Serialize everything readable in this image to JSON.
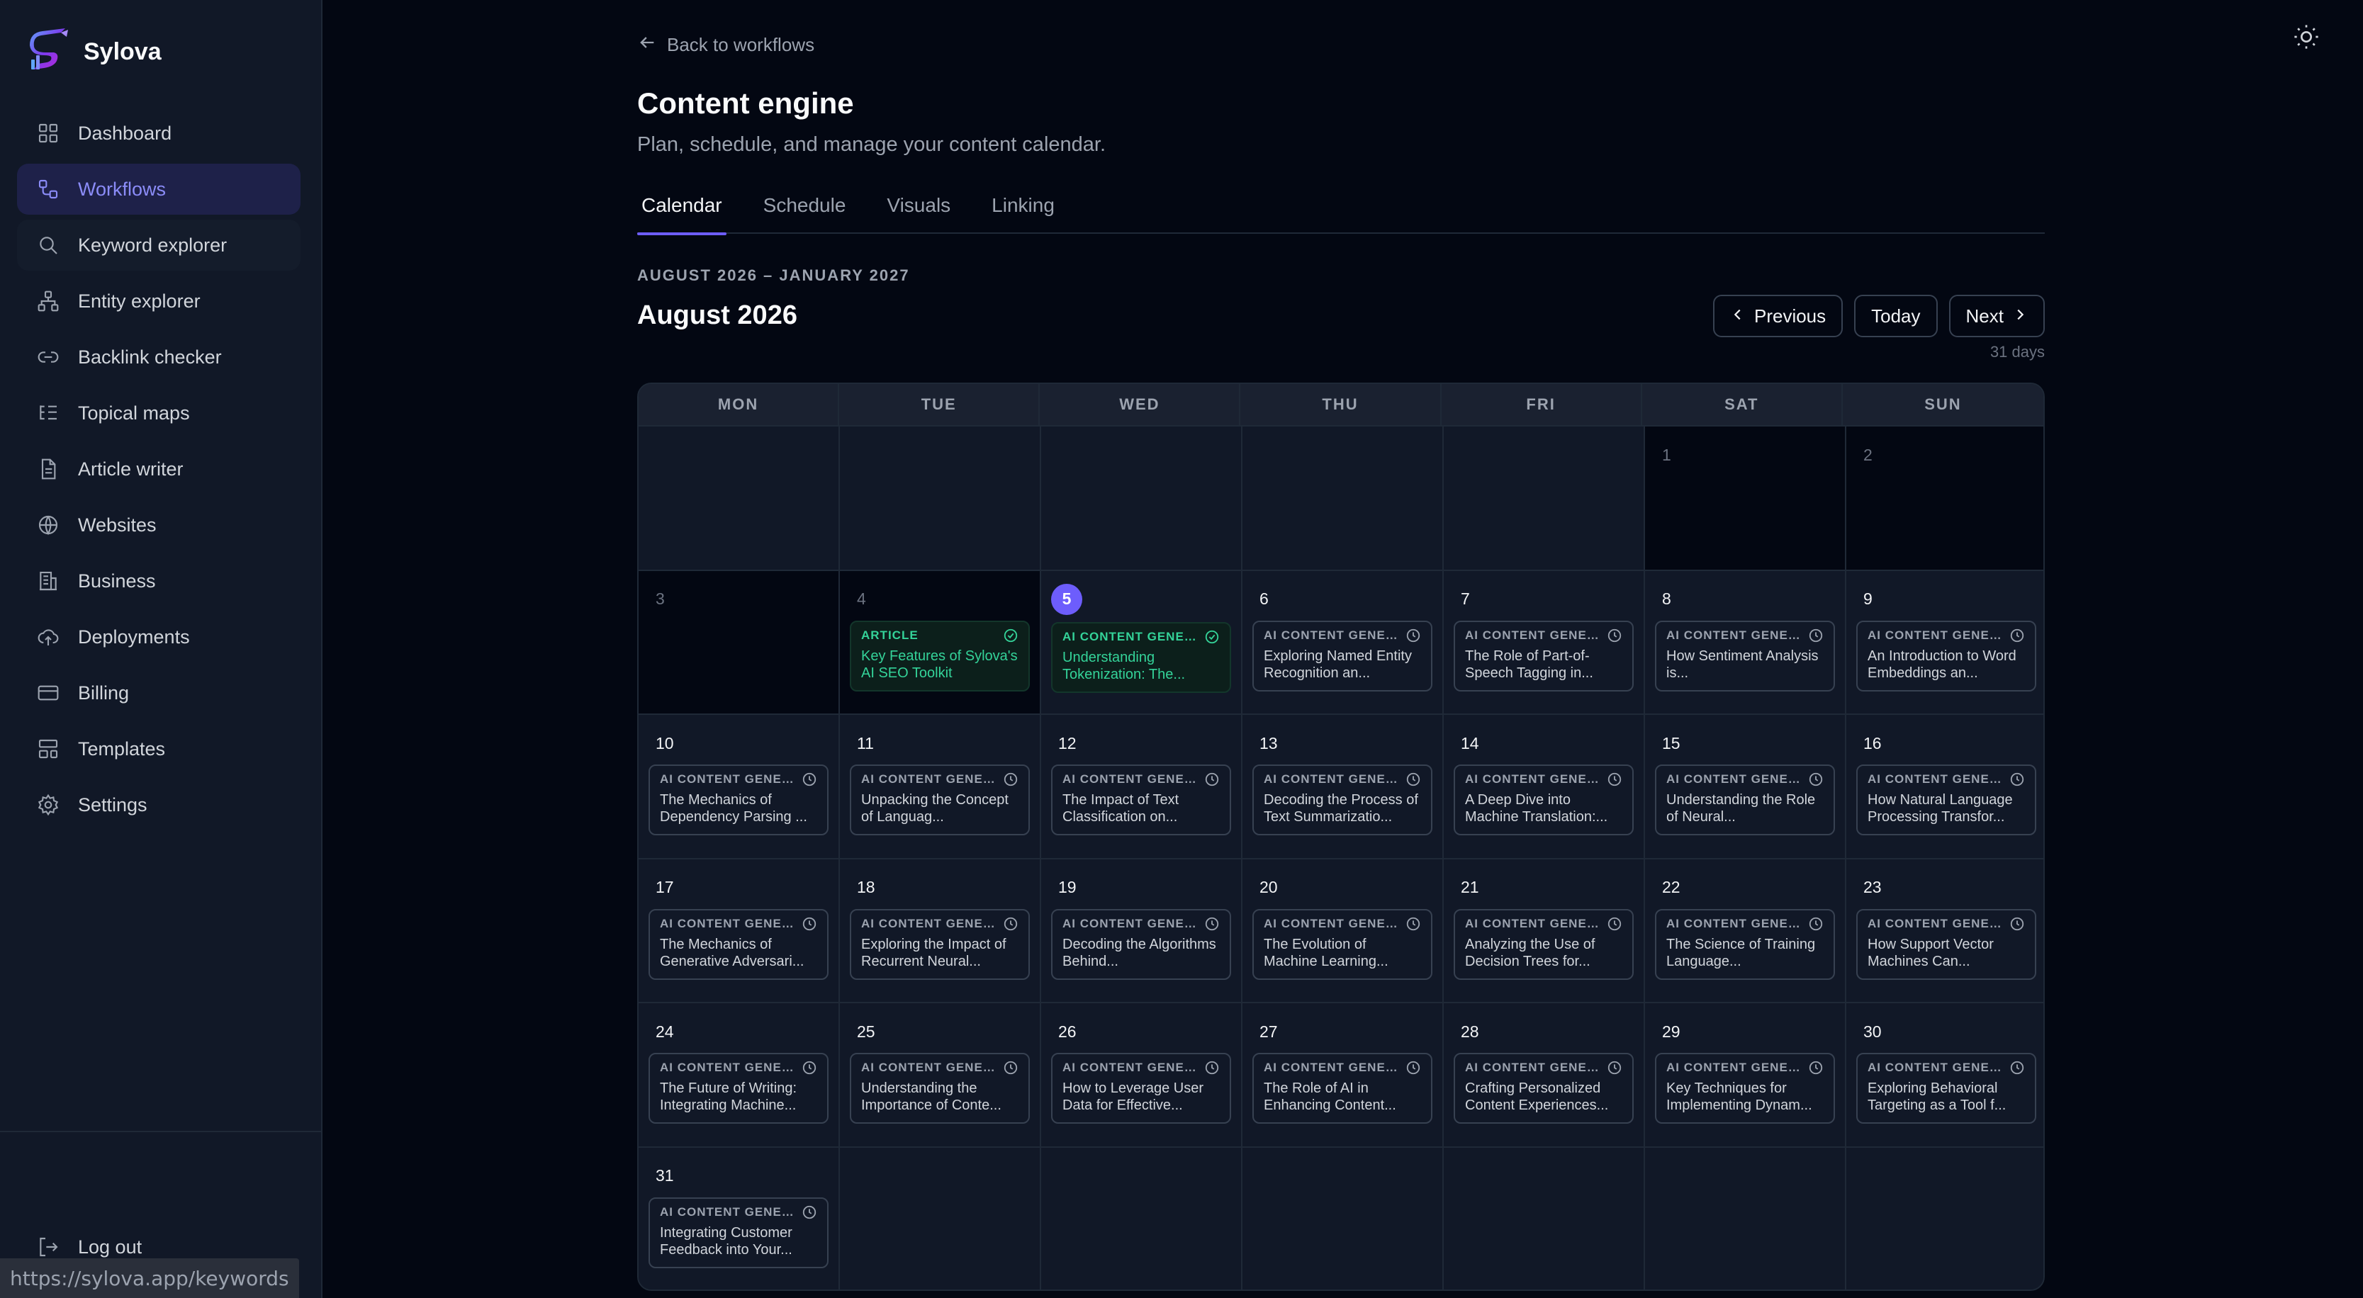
{
  "app": {
    "name": "Sylova"
  },
  "sidebar": {
    "items": [
      {
        "label": "Dashboard",
        "icon": "dashboard-icon"
      },
      {
        "label": "Workflows",
        "icon": "workflows-icon",
        "active": true
      },
      {
        "label": "Keyword explorer",
        "icon": "search-icon",
        "hover": true
      },
      {
        "label": "Entity explorer",
        "icon": "entity-icon"
      },
      {
        "label": "Backlink checker",
        "icon": "link-icon"
      },
      {
        "label": "Topical maps",
        "icon": "list-tree-icon"
      },
      {
        "label": "Article writer",
        "icon": "document-icon"
      },
      {
        "label": "Websites",
        "icon": "globe-icon"
      },
      {
        "label": "Business",
        "icon": "building-icon"
      },
      {
        "label": "Deployments",
        "icon": "cloud-upload-icon"
      },
      {
        "label": "Billing",
        "icon": "credit-card-icon"
      },
      {
        "label": "Templates",
        "icon": "templates-icon"
      },
      {
        "label": "Settings",
        "icon": "gear-icon"
      }
    ],
    "logout": "Log out"
  },
  "status_url": "https://sylova.app/keywords",
  "header": {
    "back": "Back to workflows",
    "title": "Content engine",
    "subtitle": "Plan, schedule, and manage your content calendar."
  },
  "tabs": [
    {
      "label": "Calendar",
      "active": true
    },
    {
      "label": "Schedule"
    },
    {
      "label": "Visuals"
    },
    {
      "label": "Linking"
    }
  ],
  "calendar": {
    "range": "AUGUST 2026 – JANUARY 2027",
    "month": "August 2026",
    "buttons": {
      "previous": "Previous",
      "today": "Today",
      "next": "Next"
    },
    "days_count": "31 days",
    "weekdays": [
      "MON",
      "TUE",
      "WED",
      "THU",
      "FRI",
      "SAT",
      "SUN"
    ],
    "leading_blanks": 5,
    "today": 5,
    "colors": {
      "accent": "#6d5dfc",
      "done": "#34d399"
    },
    "days": [
      {
        "day": "1",
        "past": true
      },
      {
        "day": "2",
        "past": true
      },
      {
        "day": "3",
        "past": true
      },
      {
        "day": "4",
        "past": true,
        "event": {
          "type": "ARTICLE",
          "title": "Key Features of Sylova's AI SEO Toolkit",
          "status": "done"
        }
      },
      {
        "day": "5",
        "today": true,
        "event": {
          "type": "AI CONTENT GENER...",
          "title": "Understanding Tokenization: The...",
          "status": "done"
        }
      },
      {
        "day": "6",
        "event": {
          "type": "AI CONTENT GENER...",
          "title": "Exploring Named Entity Recognition an...",
          "status": "scheduled"
        }
      },
      {
        "day": "7",
        "event": {
          "type": "AI CONTENT GENER...",
          "title": "The Role of Part-of-Speech Tagging in...",
          "status": "scheduled"
        }
      },
      {
        "day": "8",
        "event": {
          "type": "AI CONTENT GENER...",
          "title": "How Sentiment Analysis is...",
          "status": "scheduled"
        }
      },
      {
        "day": "9",
        "event": {
          "type": "AI CONTENT GENER...",
          "title": "An Introduction to Word Embeddings an...",
          "status": "scheduled"
        }
      },
      {
        "day": "10",
        "event": {
          "type": "AI CONTENT GENER...",
          "title": "The Mechanics of Dependency Parsing ...",
          "status": "scheduled"
        }
      },
      {
        "day": "11",
        "event": {
          "type": "AI CONTENT GENER...",
          "title": "Unpacking the Concept of Languag...",
          "status": "scheduled"
        }
      },
      {
        "day": "12",
        "event": {
          "type": "AI CONTENT GENER...",
          "title": "The Impact of Text Classification on...",
          "status": "scheduled"
        }
      },
      {
        "day": "13",
        "event": {
          "type": "AI CONTENT GENER...",
          "title": "Decoding the Process of Text Summarizatio...",
          "status": "scheduled"
        }
      },
      {
        "day": "14",
        "event": {
          "type": "AI CONTENT GENER...",
          "title": "A Deep Dive into Machine Translation:...",
          "status": "scheduled"
        }
      },
      {
        "day": "15",
        "event": {
          "type": "AI CONTENT GENER...",
          "title": "Understanding the Role of Neural...",
          "status": "scheduled"
        }
      },
      {
        "day": "16",
        "event": {
          "type": "AI CONTENT GENER...",
          "title": "How Natural Language Processing Transfor...",
          "status": "scheduled"
        }
      },
      {
        "day": "17",
        "event": {
          "type": "AI CONTENT GENER...",
          "title": "The Mechanics of Generative Adversari...",
          "status": "scheduled"
        }
      },
      {
        "day": "18",
        "event": {
          "type": "AI CONTENT GENER...",
          "title": "Exploring the Impact of Recurrent Neural...",
          "status": "scheduled"
        }
      },
      {
        "day": "19",
        "event": {
          "type": "AI CONTENT GENER...",
          "title": "Decoding the Algorithms Behind...",
          "status": "scheduled"
        }
      },
      {
        "day": "20",
        "event": {
          "type": "AI CONTENT GENER...",
          "title": "The Evolution of Machine Learning...",
          "status": "scheduled"
        }
      },
      {
        "day": "21",
        "event": {
          "type": "AI CONTENT GENER...",
          "title": "Analyzing the Use of Decision Trees for...",
          "status": "scheduled"
        }
      },
      {
        "day": "22",
        "event": {
          "type": "AI CONTENT GENER...",
          "title": "The Science of Training Language...",
          "status": "scheduled"
        }
      },
      {
        "day": "23",
        "event": {
          "type": "AI CONTENT GENER...",
          "title": "How Support Vector Machines Can...",
          "status": "scheduled"
        }
      },
      {
        "day": "24",
        "event": {
          "type": "AI CONTENT GENER...",
          "title": "The Future of Writing: Integrating Machine...",
          "status": "scheduled"
        }
      },
      {
        "day": "25",
        "event": {
          "type": "AI CONTENT GENER...",
          "title": "Understanding the Importance of Conte...",
          "status": "scheduled"
        }
      },
      {
        "day": "26",
        "event": {
          "type": "AI CONTENT GENER...",
          "title": "How to Leverage User Data for Effective...",
          "status": "scheduled"
        }
      },
      {
        "day": "27",
        "event": {
          "type": "AI CONTENT GENER...",
          "title": "The Role of AI in Enhancing Content...",
          "status": "scheduled"
        }
      },
      {
        "day": "28",
        "event": {
          "type": "AI CONTENT GENER...",
          "title": "Crafting Personalized Content Experiences...",
          "status": "scheduled"
        }
      },
      {
        "day": "29",
        "event": {
          "type": "AI CONTENT GENER...",
          "title": "Key Techniques for Implementing Dynam...",
          "status": "scheduled"
        }
      },
      {
        "day": "30",
        "event": {
          "type": "AI CONTENT GENER...",
          "title": "Exploring Behavioral Targeting as a Tool f...",
          "status": "scheduled"
        }
      },
      {
        "day": "31",
        "event": {
          "type": "AI CONTENT GENER...",
          "title": "Integrating Customer Feedback into Your...",
          "status": "scheduled"
        }
      }
    ],
    "trailing_blanks": 6
  }
}
